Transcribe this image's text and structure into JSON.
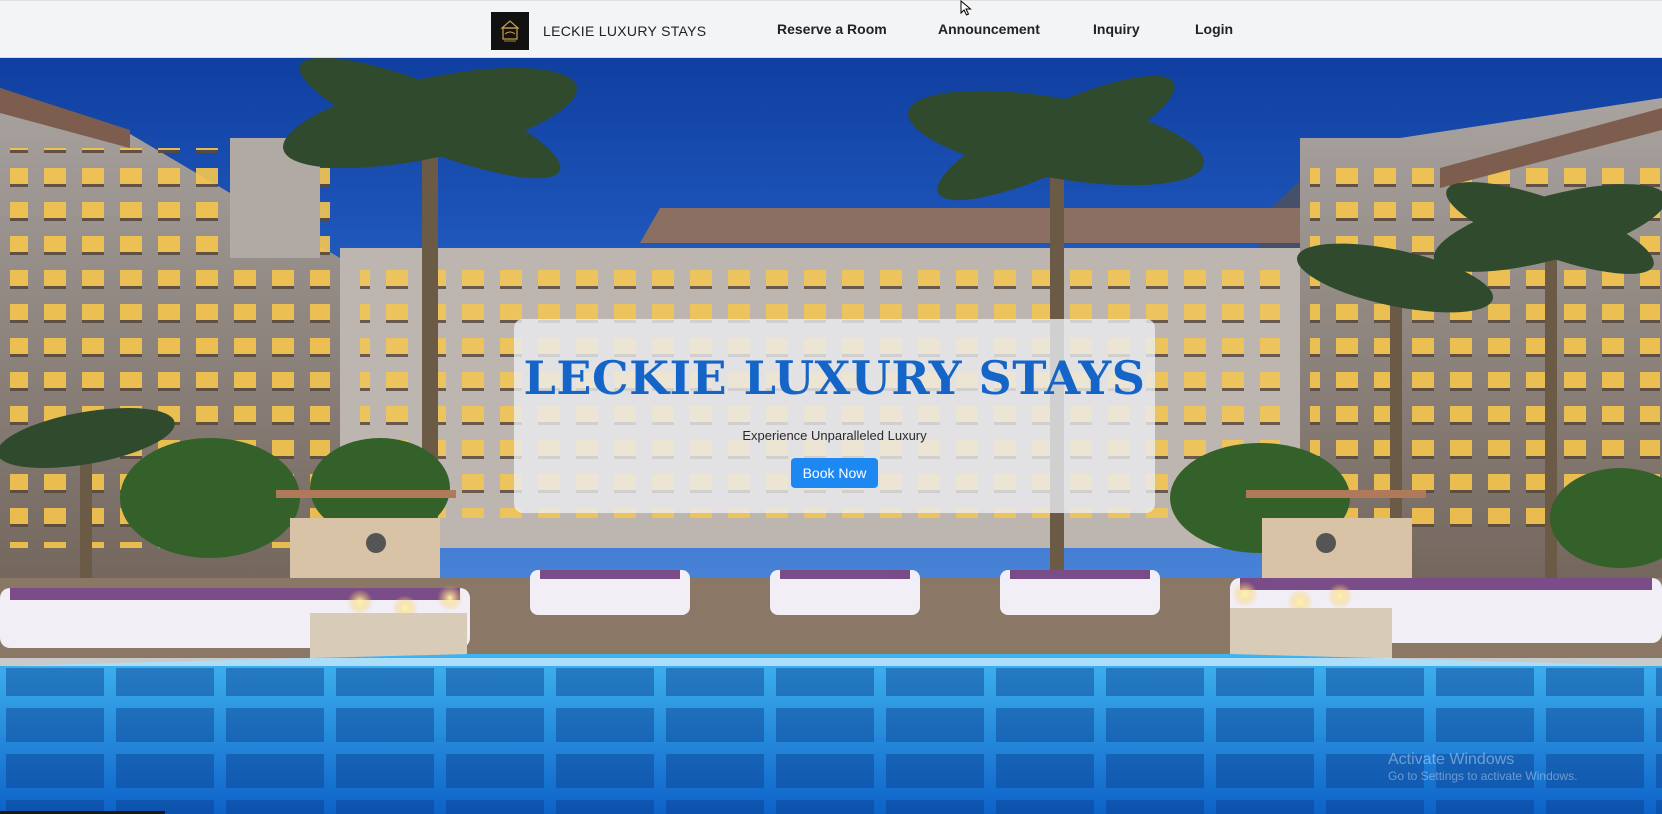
{
  "brand": {
    "name": "LECKIE LUXURY STAYS",
    "logo_icon": "hotel-crest-logo",
    "logo_color": "#c9a24a"
  },
  "nav": {
    "links": [
      "Reserve a Room",
      "Announcement",
      "Inquiry",
      "Login"
    ]
  },
  "hero": {
    "title": "LECKIE LUXURY STAYS",
    "subtitle": "Experience Unparalleled Luxury",
    "cta_label": "Book Now",
    "title_color": "#1565c8",
    "cta_color": "#1e88f2",
    "background": "resort-pool-night-photo"
  },
  "watermark": {
    "line1": "Activate Windows",
    "line2": "Go to Settings to activate Windows."
  }
}
